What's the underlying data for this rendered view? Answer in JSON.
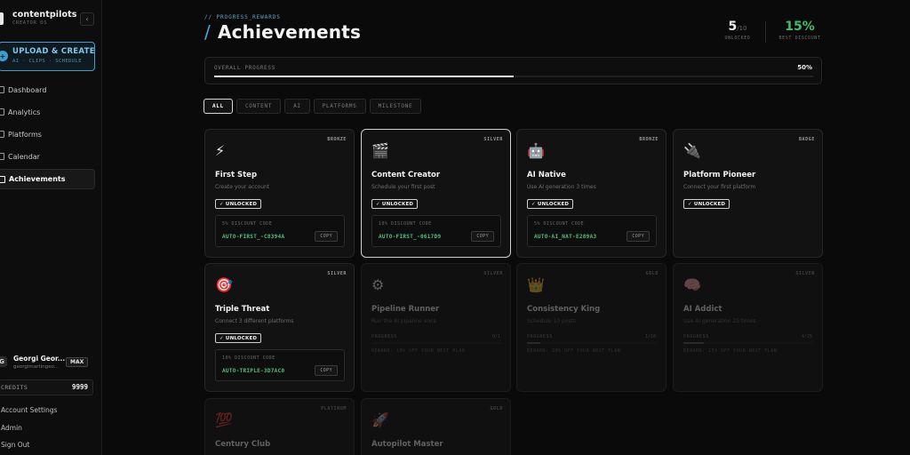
{
  "brand": {
    "name": "contentpilots",
    "sub": "CREATOR OS"
  },
  "sidebar": {
    "collapse_glyph": "‹",
    "upload": {
      "title": "UPLOAD & CREATE",
      "sub": "AI · CLIPS · SCHEDULE",
      "icon": "+"
    },
    "nav": [
      {
        "label": "Dashboard",
        "icon": "dashboard-icon"
      },
      {
        "label": "Analytics",
        "icon": "analytics-icon"
      },
      {
        "label": "Platforms",
        "icon": "platforms-icon"
      },
      {
        "label": "Calendar",
        "icon": "calendar-icon"
      },
      {
        "label": "Achievements",
        "icon": "achievements-icon"
      }
    ],
    "user": {
      "initial": "G",
      "name": "Georgi Geor...",
      "email": "georgimartingeo...",
      "plan": "MAX"
    },
    "credits": {
      "label": "CREDITS",
      "value": "9999"
    },
    "footer": [
      "Account Settings",
      "Admin",
      "Sign Out"
    ]
  },
  "header": {
    "crumb": "// PROGRESS_REWARDS",
    "slash": "/",
    "title": "Achievements",
    "stats": [
      {
        "value": "5",
        "suffix": "/10",
        "label": "UNLOCKED"
      },
      {
        "value": "15%",
        "suffix": "",
        "label": "BEST DISCOUNT",
        "color": "#3fbf6e"
      }
    ]
  },
  "progress": {
    "label": "OVERALL PROGRESS",
    "percent_text": "50%",
    "fraction": 0.5
  },
  "filters": [
    "ALL",
    "CONTENT",
    "AI",
    "PLATFORMS",
    "MILESTONE"
  ],
  "cards": [
    {
      "tier": "BRONZE",
      "icon": "lightning-icon",
      "emoji": "⚡",
      "name": "First Step",
      "desc": "Create your account",
      "status": "unlocked",
      "badge": "✓ UNLOCKED",
      "code_label": "5% DISCOUNT CODE",
      "code": "AUTO-FIRST_-C8394A",
      "copy": "COPY"
    },
    {
      "tier": "SILVER",
      "icon": "clapper-icon",
      "emoji": "🎬",
      "name": "Content Creator",
      "desc": "Schedule your first post",
      "status": "unlocked",
      "badge": "✓ UNLOCKED",
      "code_label": "10% DISCOUNT CODE",
      "code": "AUTO-FIRST_-0617D9",
      "copy": "COPY"
    },
    {
      "tier": "BRONZE",
      "icon": "robot-icon",
      "emoji": "🤖",
      "name": "AI Native",
      "desc": "Use AI generation 3 times",
      "status": "unlocked",
      "badge": "✓ UNLOCKED",
      "code_label": "5% DISCOUNT CODE",
      "code": "AUTO-AI_NAT-E289A3",
      "copy": "COPY"
    },
    {
      "tier": "BADGE",
      "icon": "plug-icon",
      "emoji": "🔌",
      "name": "Platform Pioneer",
      "desc": "Connect your first platform",
      "status": "unlocked",
      "badge": "✓ UNLOCKED"
    },
    {
      "tier": "SILVER",
      "icon": "target-icon",
      "emoji": "🎯",
      "name": "Triple Threat",
      "desc": "Connect 3 different platforms",
      "status": "unlocked",
      "badge": "✓ UNLOCKED",
      "code_label": "10% DISCOUNT CODE",
      "code": "AUTO-TRIPLE-3D7AC0",
      "copy": "COPY"
    },
    {
      "tier": "SILVER",
      "icon": "gear-icon",
      "emoji": "⚙",
      "name": "Pipeline Runner",
      "desc": "Run the AI pipeline once",
      "status": "locked",
      "progress_label": "PROGRESS",
      "progress_text": "0/1",
      "progress": 0.0,
      "reward": "REWARD: 10% OFF YOUR NEXT PLAN"
    },
    {
      "tier": "GOLD",
      "icon": "crown-icon",
      "emoji": "👑",
      "name": "Consistency King",
      "desc": "Schedule 10 posts",
      "status": "locked",
      "progress_label": "PROGRESS",
      "progress_text": "1/10",
      "progress": 0.1,
      "reward": "REWARD: 20% OFF YOUR NEXT PLAN"
    },
    {
      "tier": "SILVER",
      "icon": "brain-icon",
      "emoji": "🧠",
      "name": "AI Addict",
      "desc": "Use AI generation 25 times",
      "status": "locked",
      "progress_label": "PROGRESS",
      "progress_text": "4/25",
      "progress": 0.16,
      "reward": "REWARD: 15% OFF YOUR NEXT PLAN"
    },
    {
      "tier": "PLATINUM",
      "icon": "hundred-icon",
      "emoji": "💯",
      "name": "Century Club",
      "desc": "",
      "status": "locked"
    },
    {
      "tier": "GOLD",
      "icon": "rocket-icon",
      "emoji": "🚀",
      "name": "Autopilot Master",
      "desc": "",
      "status": "locked"
    }
  ]
}
